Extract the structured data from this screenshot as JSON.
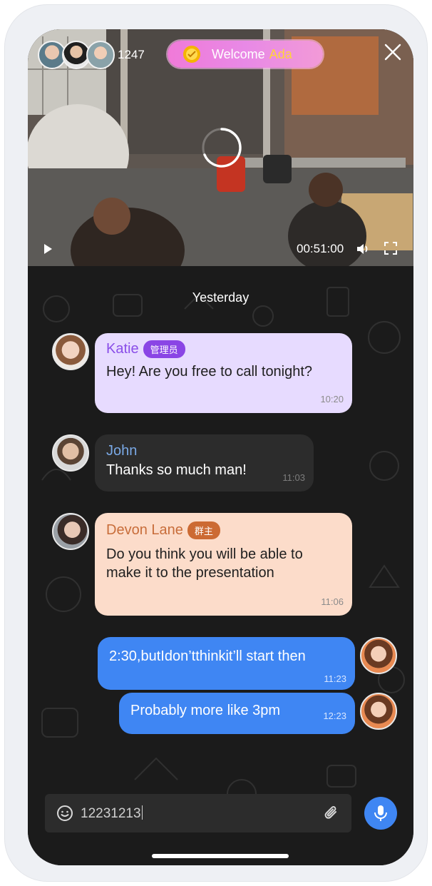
{
  "live": {
    "viewer_count": "1247",
    "welcome_prefix": "Welcome",
    "welcome_name": "Ada",
    "time": "00:51:00"
  },
  "chat": {
    "date_separator": "Yesterday",
    "messages": [
      {
        "sender": "Katie",
        "tag": "管理员",
        "text": "Hey! Are you free to call tonight?",
        "time": "10:20",
        "color": "#e7dbff"
      },
      {
        "sender": "John",
        "text": "Thanks so much man!",
        "time": "11:03",
        "color": "#2c2c2c"
      },
      {
        "sender": "Devon Lane",
        "tag": "群主",
        "text": "Do you think you will be able to make it to the presentation",
        "time": "11:06",
        "color": "#fcdcca"
      },
      {
        "text": "2:30,butIdon’tthinkit’ll start then",
        "time": "11:23",
        "color": "#3f86f3"
      },
      {
        "text": "Probably more like 3pm",
        "time": "12:23",
        "color": "#3f86f3"
      }
    ]
  },
  "composer": {
    "value": "12231213"
  },
  "icons": {
    "close": "close-icon",
    "play": "play-icon",
    "volume": "volume-icon",
    "fullscreen": "fullscreen-icon",
    "emoji": "emoji-icon",
    "attach": "paperclip-icon",
    "mic": "microphone-icon"
  }
}
